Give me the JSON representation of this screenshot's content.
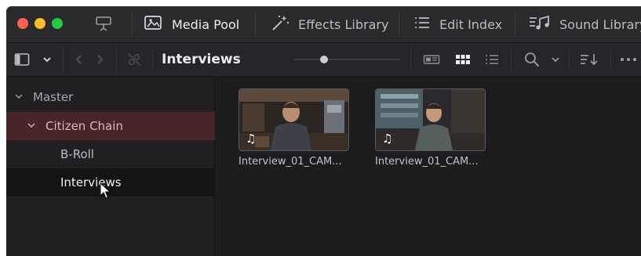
{
  "window": {
    "traffic_lights": {
      "close": "#ff5f57",
      "minimize": "#febc2e",
      "zoom": "#28c840"
    }
  },
  "toolbar": {
    "collapse_icon": "panel-toggle-icon",
    "items": [
      {
        "label": "Media Pool",
        "icon": "media-pool-icon",
        "active": true
      },
      {
        "label": "Effects Library",
        "icon": "magic-wand-icon",
        "active": false
      },
      {
        "label": "Edit Index",
        "icon": "list-icon",
        "active": false
      },
      {
        "label": "Sound Library",
        "icon": "sound-library-icon",
        "active": false
      }
    ]
  },
  "bin_bar": {
    "title": "Interviews",
    "zoom_level": 0.28,
    "icons": [
      "sidebar-toggle-icon",
      "chevron-down-icon",
      "back-arrow-icon",
      "forward-arrow-icon",
      "link-icon",
      "metadata-view-icon",
      "thumbnail-view-icon",
      "list-view-icon",
      "search-icon",
      "chevron-down-icon",
      "sort-icon",
      "more-options-icon"
    ]
  },
  "sidebar": {
    "items": [
      {
        "label": "Master",
        "expanded": true
      },
      {
        "label": "Citizen Chain",
        "expanded": true
      },
      {
        "label": "B-Roll"
      },
      {
        "label": "Interviews",
        "selected": true
      }
    ]
  },
  "clips": [
    {
      "name": "Interview_01_CAM...",
      "badge": "audio-note-icon"
    },
    {
      "name": "Interview_01_CAM...",
      "badge": "audio-note-icon"
    }
  ],
  "colors": {
    "accent_bin": "#4a2427",
    "selected_row": "#131315",
    "background": "#1e1e21"
  }
}
